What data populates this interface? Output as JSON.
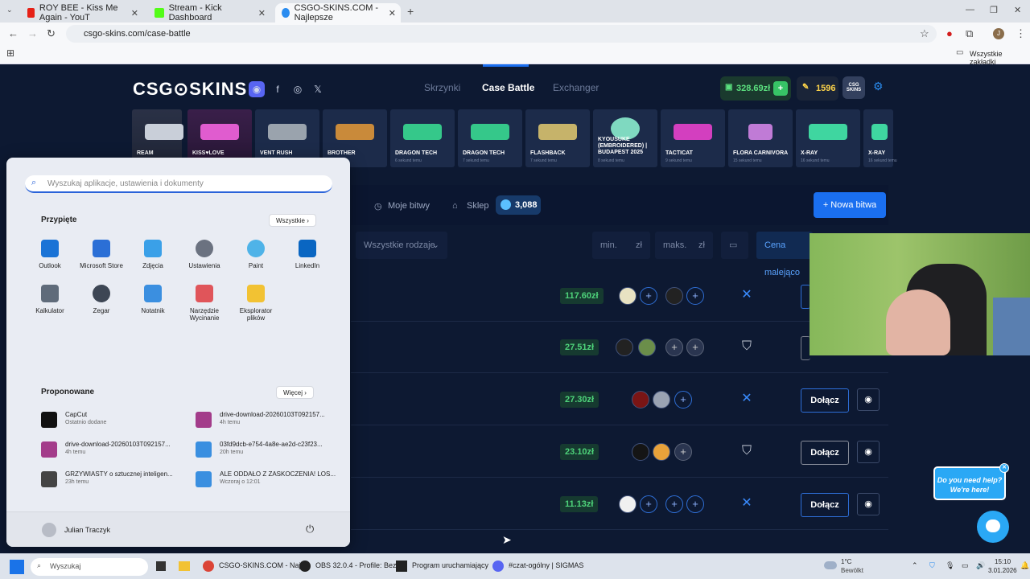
{
  "browser": {
    "tabs": [
      {
        "title": "ROY BEE - Kiss Me Again - YouT",
        "color": "#e62117"
      },
      {
        "title": "Stream - Kick Dashboard",
        "color": "#53fc18"
      },
      {
        "title": "CSGO-SKINS.COM - Najlepsze",
        "color": "#2a8cf0"
      }
    ],
    "new_tab": "+",
    "url": "csgo-skins.com/case-battle",
    "bookmarks_label": "Wszystkie zakładki"
  },
  "site": {
    "logo": "CSG⊙SKINS",
    "nav": [
      {
        "label": "Skrzynki"
      },
      {
        "label": "Case Battle"
      },
      {
        "label": "Exchanger"
      }
    ],
    "balance": "328.69zł",
    "gold": "1596",
    "feed": [
      {
        "name": "REAM",
        "time": "",
        "color": "#c9cfd9"
      },
      {
        "name": "KISS♥LOVE",
        "time": "",
        "color": "#e05ccf"
      },
      {
        "name": "VENT RUSH",
        "time": "",
        "color": "#9aa3ad"
      },
      {
        "name": "BROTHER",
        "time": "",
        "color": "#c98a3a"
      },
      {
        "name": "DRAGON TECH",
        "time": "6 sekund temu",
        "color": "#35c88a"
      },
      {
        "name": "DRAGON TECH",
        "time": "7 sekund temu",
        "color": "#35c88a"
      },
      {
        "name": "FLASHBACK",
        "time": "7 sekund temu",
        "color": "#c6b36a"
      },
      {
        "name": "KYOUSUKE (EMBROIDERED) | BUDAPEST 2025",
        "time": "8 sekund temu",
        "color": "#7fd9c0"
      },
      {
        "name": "TACTICAT",
        "time": "9 sekund temu",
        "color": "#d33fbf"
      },
      {
        "name": "FLORA CARNIVORA",
        "time": "15 sekund temu",
        "color": "#c07bd6"
      },
      {
        "name": "X-RAY",
        "time": "16 sekund temu",
        "color": "#3fd6a0"
      },
      {
        "name": "X-RAY",
        "time": "16 sekund temu",
        "color": "#3fd6a0"
      }
    ],
    "controls": {
      "my_battles": "Moje bitwy",
      "shop": "Sklep",
      "coins": "3,088",
      "new_battle": "+ Nowa bitwa",
      "all_types": "Wszystkie rodzaje",
      "min": "min.",
      "max": "maks.",
      "currency": "zł",
      "sort": "Cena malejąco"
    },
    "battles": [
      {
        "price": "117.60zł",
        "mode": "x",
        "join": ""
      },
      {
        "price": "27.51zł",
        "mode": "shield",
        "join": ""
      },
      {
        "price": "27.30zł",
        "mode": "x",
        "join": "Dołącz"
      },
      {
        "price": "23.10zł",
        "mode": "shield",
        "join": "Dołącz"
      },
      {
        "price": "11.13zł",
        "mode": "x",
        "join": "Dołącz"
      }
    ]
  },
  "start_menu": {
    "search_placeholder": "Wyszukaj aplikacje, ustawienia i dokumenty",
    "pinned_title": "Przypięte",
    "all_button": "Wszystkie",
    "pinned": [
      {
        "label": "Outlook",
        "color": "#1a73d6"
      },
      {
        "label": "Microsoft Store",
        "color": "#2b6fd6"
      },
      {
        "label": "Zdjęcia",
        "color": "#3aa0e8"
      },
      {
        "label": "Ustawienia",
        "color": "#6b7280"
      },
      {
        "label": "Paint",
        "color": "#4fb3e8"
      },
      {
        "label": "LinkedIn",
        "color": "#0a66c2"
      },
      {
        "label": "Kalkulator",
        "color": "#5f6b7a"
      },
      {
        "label": "Zegar",
        "color": "#3d4654"
      },
      {
        "label": "Notatnik",
        "color": "#3b8fe0"
      },
      {
        "label": "Narzędzie Wycinanie",
        "color": "#e0555a"
      },
      {
        "label": "Eksplorator plików",
        "color": "#f2c233"
      }
    ],
    "recommended_title": "Proponowane",
    "more_button": "Więcej",
    "recommended": [
      {
        "title": "CapCut",
        "sub": "Ostatnio dodane",
        "color": "#111"
      },
      {
        "title": "drive-download-20260103T092157...",
        "sub": "4h temu",
        "color": "#a33c8a"
      },
      {
        "title": "drive-download-20260103T092157...",
        "sub": "4h temu",
        "color": "#a33c8a"
      },
      {
        "title": "03fd9dcb-e754-4a8e-ae2d-c23f23...",
        "sub": "20h temu",
        "color": "#3a8fe0"
      },
      {
        "title": "GRZYWIASTY o sztucznej inteligen...",
        "sub": "23h temu",
        "color": "#444"
      },
      {
        "title": "ALE ODDAŁO Z ZASKOCZENIA! LOS...",
        "sub": "Wczoraj o 12:01",
        "color": "#3a8fe0"
      }
    ],
    "user": "Julian Traczyk"
  },
  "chat": {
    "bubble": "Do you need help? We're here!"
  },
  "taskbar": {
    "search": "Wyszukaj",
    "apps": [
      {
        "label": "CSGO-SKINS.COM - Naj"
      },
      {
        "label": "OBS 32.0.4 - Profile: Bez"
      },
      {
        "label": "Program uruchamiający"
      },
      {
        "label": "#czat-ogólny | SIGMAS"
      }
    ],
    "weather_temp": "1°C",
    "weather_desc": "Bewölkt",
    "time": "15:10",
    "date": "3.01.2026"
  }
}
